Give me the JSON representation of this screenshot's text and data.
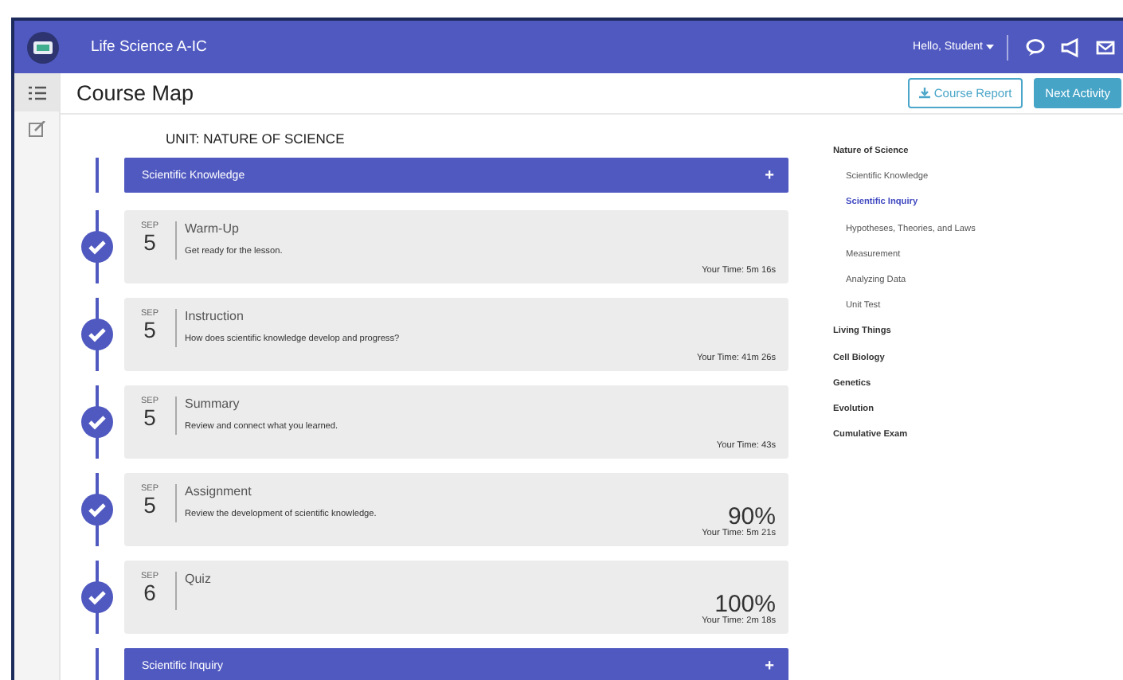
{
  "header": {
    "title": "Life Science A-IC",
    "greeting": "Hello, Student"
  },
  "toolbar": {
    "title": "Course Map",
    "buttons": [
      {
        "label": "Course Report",
        "kind": "outline"
      },
      {
        "label": "Next Activity",
        "kind": "primary"
      }
    ]
  },
  "unit": {
    "title": "UNIT: NATURE OF SCIENCE"
  },
  "sections": [
    {
      "title": "Scientific Knowledge",
      "toggle": "+",
      "activities": [
        {
          "month": "SEP",
          "day": "5",
          "title": "Warm-Up",
          "description": "Get ready for the lesson.",
          "time": "Your Time: 5m 16s",
          "completed": true
        },
        {
          "month": "SEP",
          "day": "5",
          "title": "Instruction",
          "description": "How does scientific knowledge develop and progress?",
          "time": "Your Time: 41m 26s",
          "completed": true
        },
        {
          "month": "SEP",
          "day": "5",
          "title": "Summary",
          "description": "Review and connect what you learned.",
          "time": "Your Time: 43s",
          "completed": true
        },
        {
          "month": "SEP",
          "day": "5",
          "title": "Assignment",
          "description": "Review the development of scientific knowledge.",
          "score": "90%",
          "time": "Your Time: 5m 21s",
          "completed": true
        },
        {
          "month": "SEP",
          "day": "6",
          "title": "Quiz",
          "score": "100%",
          "time": "Your Time: 2m 18s",
          "completed": true
        }
      ]
    },
    {
      "title": "Scientific Inquiry",
      "toggle": "+"
    }
  ],
  "nav": [
    {
      "label": "Nature of Science",
      "selected": false,
      "children": [
        {
          "label": "Scientific Knowledge",
          "selected": false
        },
        {
          "label": "Scientific Inquiry",
          "selected": true
        },
        {
          "label": "Hypotheses, Theories, and Laws",
          "selected": false
        },
        {
          "label": "Measurement",
          "selected": false
        },
        {
          "label": "Analyzing Data",
          "selected": false
        },
        {
          "label": "Unit Test",
          "selected": false
        }
      ]
    },
    {
      "label": "Living Things",
      "selected": false
    },
    {
      "label": "Cell Biology",
      "selected": false
    },
    {
      "label": "Genetics",
      "selected": false
    },
    {
      "label": "Evolution",
      "selected": false
    },
    {
      "label": "Cumulative Exam",
      "selected": false
    }
  ]
}
